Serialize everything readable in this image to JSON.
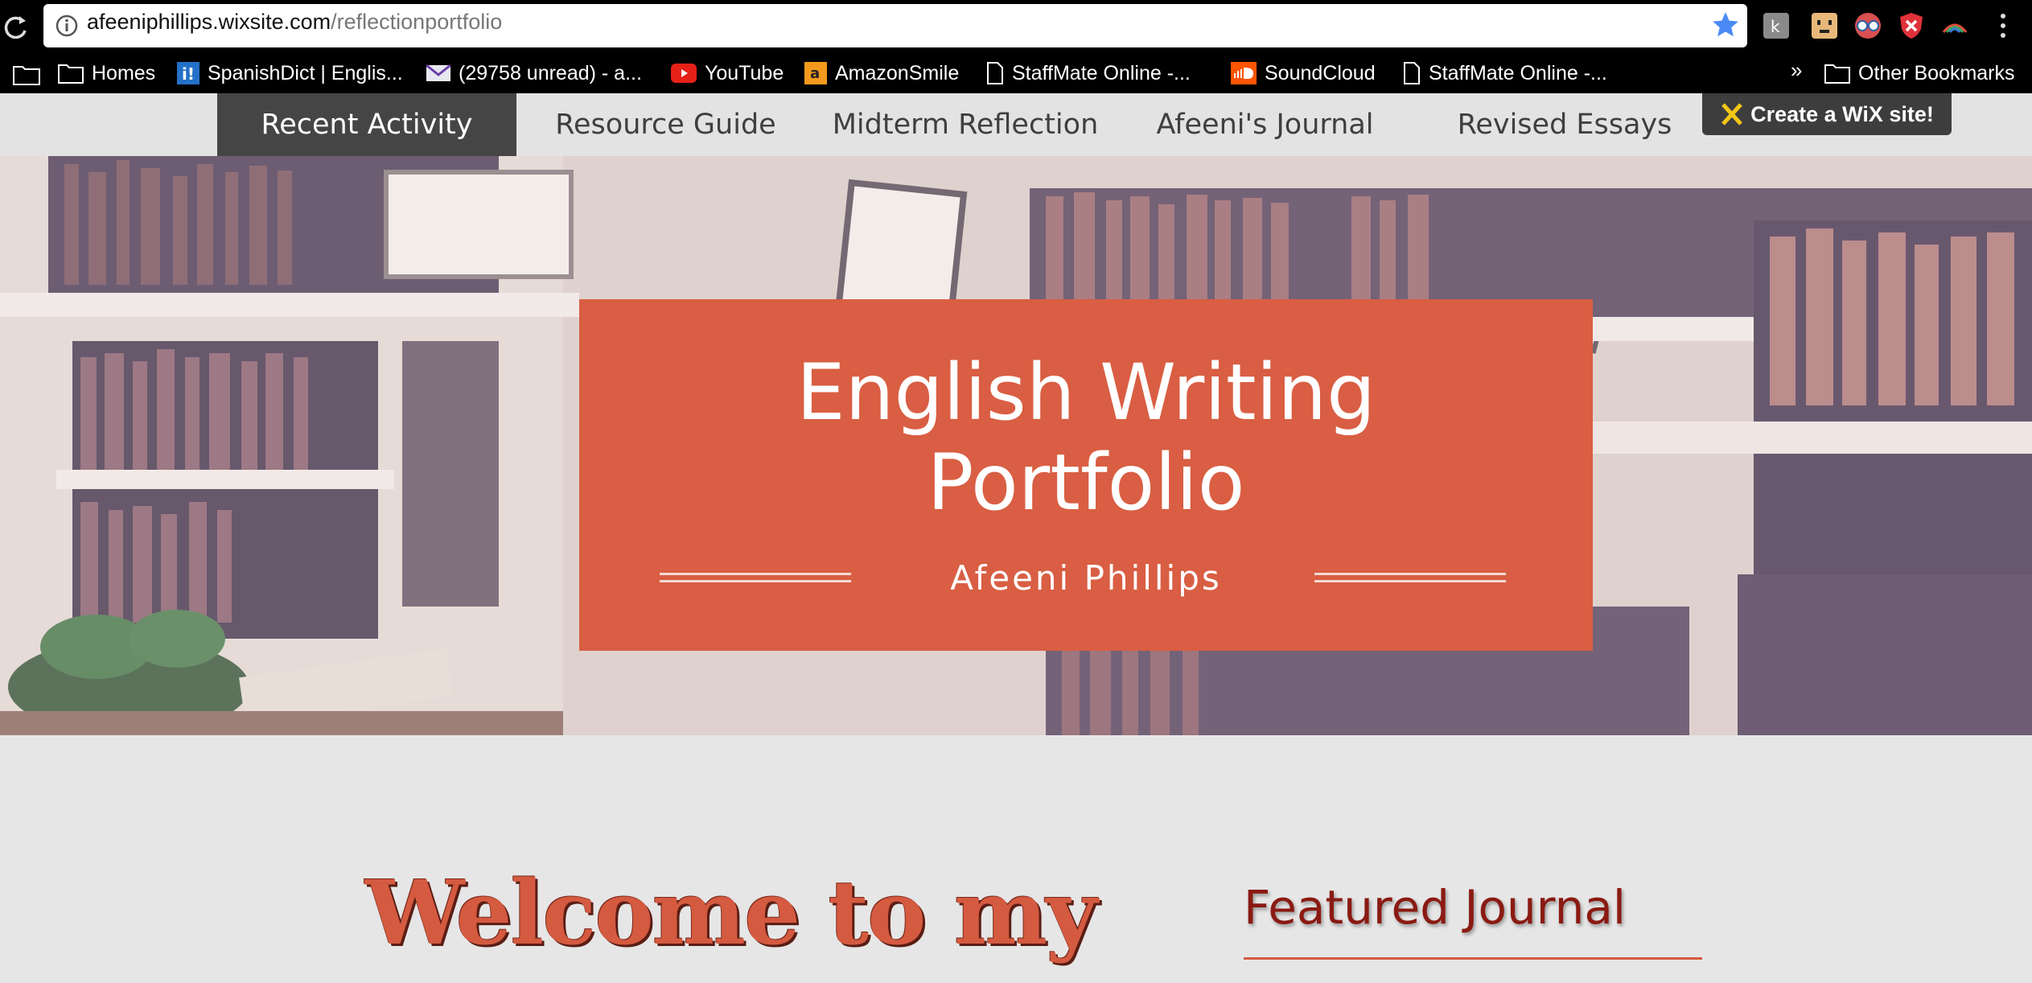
{
  "browser": {
    "url_domain": "afeeniphillips.wixsite.com",
    "url_path": "/reflectionportfolio",
    "bookmarks": [
      {
        "label": "Homes",
        "icon": "folder-icon"
      },
      {
        "label": "SpanishDict | Englis...",
        "icon": "spanishdict-icon"
      },
      {
        "label": "(29758 unread) - a...",
        "icon": "mail-icon"
      },
      {
        "label": "YouTube",
        "icon": "youtube-icon"
      },
      {
        "label": "AmazonSmile",
        "icon": "amazon-icon"
      },
      {
        "label": "StaffMate Online -...",
        "icon": "page-icon"
      },
      {
        "label": "SoundCloud",
        "icon": "soundcloud-icon"
      },
      {
        "label": "StaffMate Online -...",
        "icon": "page-icon"
      }
    ],
    "overflow": "»",
    "other_bookmarks": "Other Bookmarks"
  },
  "nav": {
    "items": [
      {
        "label": "Recent Activity",
        "active": true
      },
      {
        "label": "Resource Guide"
      },
      {
        "label": "Midterm Reflection"
      },
      {
        "label": "Afeeni's Journal"
      },
      {
        "label": "Revised Essays"
      }
    ],
    "wix_badge": "Create a WiX site!"
  },
  "hero": {
    "title_line1": "English Writing",
    "title_line2": "Portfolio",
    "subtitle": "Afeeni Phillips"
  },
  "content": {
    "welcome": "Welcome to my",
    "featured": "Featured Journal"
  },
  "colors": {
    "accent": "#d95e43",
    "nav_active": "#454545",
    "featured_text": "#8a1a12"
  }
}
